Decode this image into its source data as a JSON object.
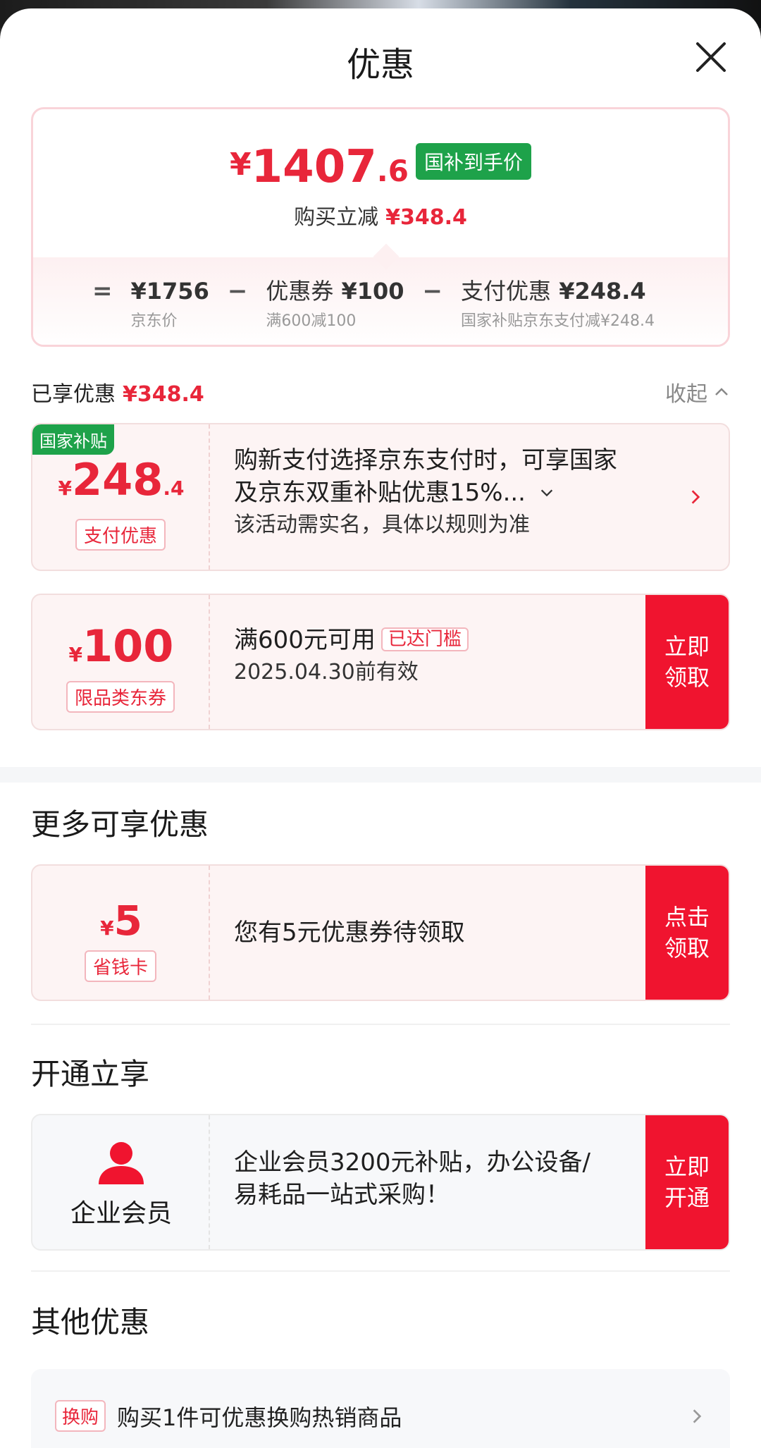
{
  "header": {
    "title": "优惠"
  },
  "summary": {
    "price_symbol": "¥",
    "price_int": "1407",
    "price_dec": ".6",
    "badge": "国补到手价",
    "saving_label": "购买立减",
    "saving_value": "¥348.4",
    "formula": {
      "eq": "=",
      "minus": "−",
      "jd_price": "¥1756",
      "jd_price_label": "京东价",
      "coupon_label": "优惠券",
      "coupon_value": "¥100",
      "coupon_sub": "满600减100",
      "pay_label": "支付优惠",
      "pay_value": "¥248.4",
      "pay_sub": "国家补贴京东支付减¥248.4"
    }
  },
  "enjoyed": {
    "label": "已享优惠",
    "value": "¥348.4",
    "collapse": "收起"
  },
  "card_subsidy": {
    "corner_tag": "国家补贴",
    "yen": "¥",
    "amount_int": "248",
    "amount_dec": ".4",
    "tag": "支付优惠",
    "desc_line1": "购新支付选择京东支付时，可享国家",
    "desc_line2": "及京东双重补贴优惠15%...",
    "desc_sub": "该活动需实名，具体以规则为准"
  },
  "card_coupon": {
    "yen": "¥",
    "amount": "100",
    "tag": "限品类东券",
    "condition": "满600元可用",
    "threshold": "已达门槛",
    "validity": "2025.04.30前有效",
    "action_line1": "立即",
    "action_line2": "领取"
  },
  "more": {
    "title": "更多可享优惠",
    "yen": "¥",
    "amount": "5",
    "tag": "省钱卡",
    "desc": "您有5元优惠券待领取",
    "action_line1": "点击",
    "action_line2": "领取"
  },
  "membership": {
    "title": "开通立享",
    "label": "企业会员",
    "desc_line1": "企业会员3200元补贴，办公设备/",
    "desc_line2": "易耗品一站式采购！",
    "action_line1": "立即",
    "action_line2": "开通"
  },
  "other": {
    "title": "其他优惠",
    "tag": "换购",
    "text": "购买1件可优惠换购热销商品"
  }
}
